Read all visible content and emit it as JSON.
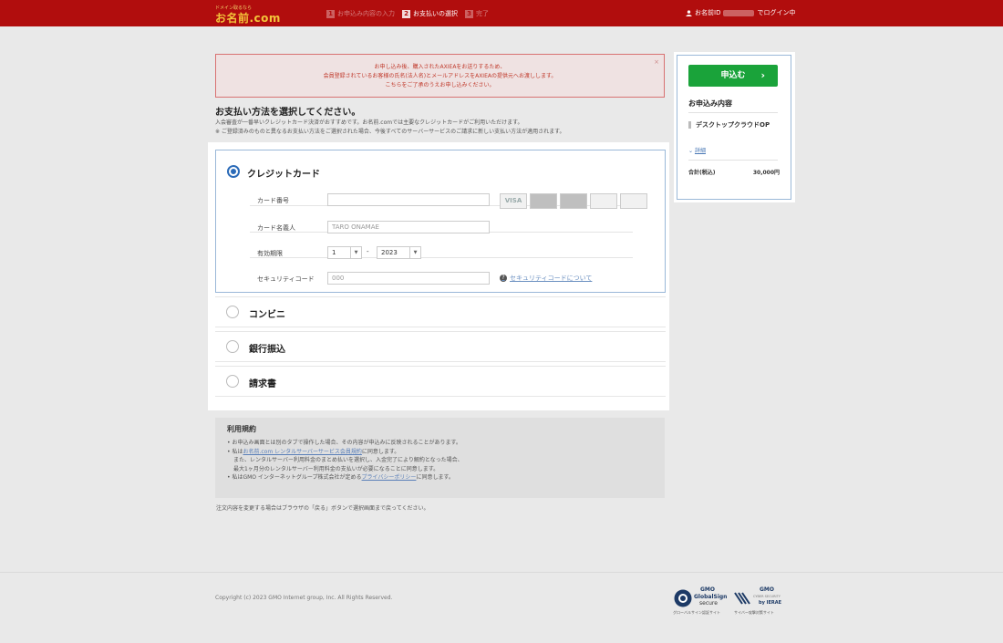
{
  "header": {
    "logo_tag": "ドメイン取るなら",
    "logo_text": "お名前.com",
    "steps": [
      {
        "num": "1",
        "label": "お申込み内容の入力"
      },
      {
        "num": "2",
        "label": "お支払いの選択"
      },
      {
        "num": "3",
        "label": "完了"
      }
    ],
    "user_prefix": "お名前ID",
    "user_suffix": "でログイン中"
  },
  "notice": {
    "lines": [
      "お申し込み後、購入されたAXIEAをお送りするため、",
      "会員登録されているお客様の氏名(法人名)とメールアドレスをAXIEAの提供元へお渡しします。",
      "こちらをご了承のうえお申し込みください。"
    ],
    "close": "×"
  },
  "payment": {
    "title": "お支払い方法を選択してください。",
    "desc_lines": [
      "入会審査が一番早いクレジットカード決済がおすすめです。お名前.comでは主要なクレジットカードがご利用いただけます。",
      "※ ご登録済みのものと異なるお支払い方法をご選択された場合、今後すべてのサーバーサービスのご請求に新しい支払い方法が適用されます。"
    ],
    "credit": {
      "name": "クレジットカード",
      "card_number_label": "カード番号",
      "card_holder_label": "カード名義人",
      "card_holder_placeholder": "TARO ONAMAE",
      "expiry_label": "有効期限",
      "expiry_month": "1",
      "expiry_sep": "-",
      "expiry_year": "2023",
      "security_label": "セキュリティコード",
      "security_placeholder": "000",
      "security_help": "セキュリティコードについて",
      "card_brands": [
        "VISA",
        "",
        "",
        "",
        ""
      ]
    },
    "methods": [
      "コンビニ",
      "銀行振込",
      "請求書"
    ]
  },
  "terms": {
    "title": "利用規約",
    "line1": "• お申込み画面とは別のタブで操作した場合、その内容が申込みに反映されることがあります。",
    "line2_pre": "• 私は",
    "line2_link": "お名前.com レンタルサーバーサービス会員規約",
    "line2_post": "に同意します。",
    "line3": "また、レンタルサーバー利用料金のまとめ払いを選択し、入金完了により解約となった場合、",
    "line4": "最大1ヶ月分のレンタルサーバー利用料金の支払いが必要になることに同意します。",
    "line5_pre": "• 私はGMO インターネットグループ株式会社が定める",
    "line5_link": "プライバシーポリシー",
    "line5_post": "に同意します。"
  },
  "back_note": "注文内容を変更する場合はブラウザの「戻る」ボタンで選択画面まで戻ってください。",
  "summary": {
    "apply_label": "申込む",
    "title": "お申込み内容",
    "item": "デスクトップクラウドOP",
    "detail": "詳細",
    "total_label": "合計(税込)",
    "total_value": "30,000円"
  },
  "footer": {
    "copyright": "Copyright (c) 2023 GMO Internet group, Inc. All Rights Reserved.",
    "seal1_brand": "GMO",
    "seal1_name": "GlobalSign",
    "seal1_secure": "secure",
    "seal1_caption": "グローバルサイン認証サイト",
    "seal2_brand": "GMO",
    "seal2_name": "CYBER SECURITY",
    "seal2_by": "by IERAE",
    "seal2_caption": "サイバー攻撃対策サイト"
  },
  "colors": {
    "header_red": "#b10d0d",
    "accent_blue": "#2b6bb8",
    "apply_green": "#1aa33a"
  }
}
